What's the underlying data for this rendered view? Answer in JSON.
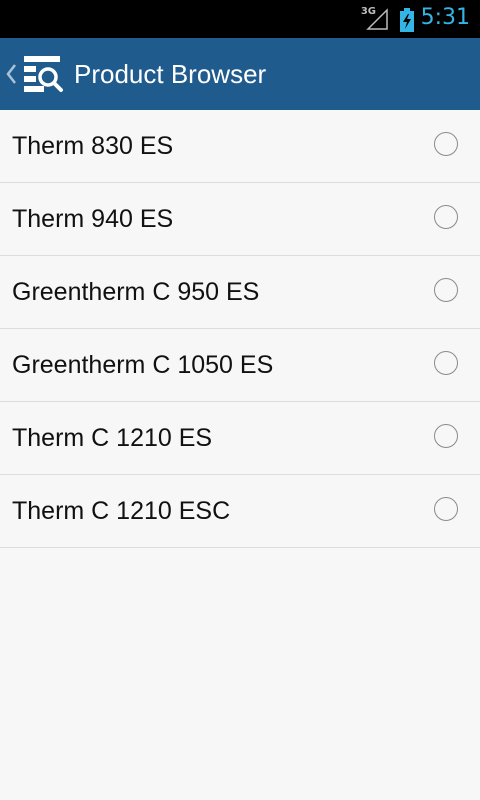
{
  "status_bar": {
    "network": "3G",
    "time": "5:31",
    "icons": [
      "signal-icon",
      "battery-charging-icon"
    ],
    "clock_color": "#33b5e5"
  },
  "action_bar": {
    "title": "Product Browser",
    "background_color": "#1f5b8d",
    "icons": [
      "chevron-left-icon",
      "product-browser-icon"
    ]
  },
  "products": [
    {
      "label": "Therm 830 ES",
      "selected": false
    },
    {
      "label": "Therm 940 ES",
      "selected": false
    },
    {
      "label": "Greentherm C 950 ES",
      "selected": false
    },
    {
      "label": "Greentherm C 1050 ES",
      "selected": false
    },
    {
      "label": "Therm C 1210 ES",
      "selected": false
    },
    {
      "label": "Therm C 1210 ESC",
      "selected": false
    }
  ]
}
